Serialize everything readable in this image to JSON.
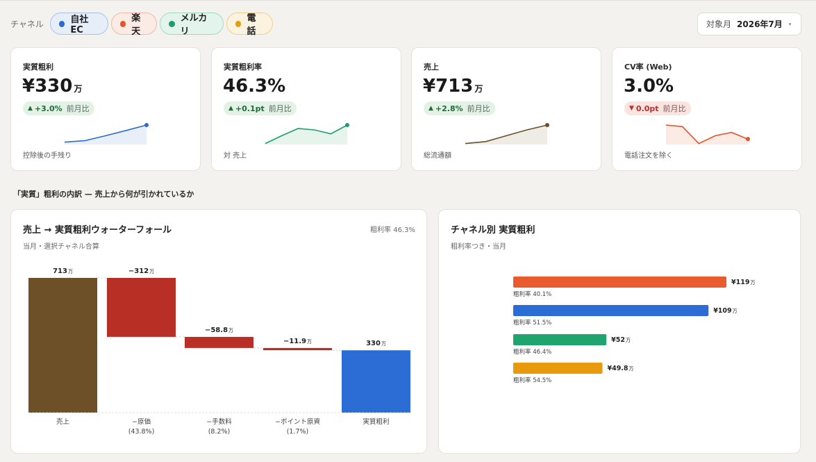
{
  "filters": {
    "channel_label": "チャネル",
    "channels": [
      {
        "name": "自社EC",
        "dot": "#2b6bd1",
        "bg": "#e6eef9",
        "border": "#a9c1ea"
      },
      {
        "name": "楽天",
        "dot": "#e0552b",
        "bg": "#fcebe4",
        "border": "#f0b9a5"
      },
      {
        "name": "メルカリ",
        "dot": "#1a9e6a",
        "bg": "#e3f4ec",
        "border": "#a3d8bf"
      },
      {
        "name": "電話",
        "dot": "#e79b0e",
        "bg": "#fcf2e0",
        "border": "#f0cf94"
      }
    ],
    "month_key": "対象月",
    "month_value": "2026年7月",
    "caret": "▾"
  },
  "kpis": [
    {
      "title": "実質粗利",
      "value": "¥330",
      "unit": "万",
      "delta": "+3.0%",
      "direction": "up",
      "arrow": "▲",
      "compare": "前月比",
      "note": "控除後の手残り",
      "color": "#2b6bd1",
      "fill": "#e9eff9",
      "spark": [
        0.12,
        0.2,
        0.45,
        0.72,
        1.0
      ]
    },
    {
      "title": "実質粗利率",
      "value": "46.3%",
      "unit": "",
      "delta": "+0.1pt",
      "direction": "up",
      "arrow": "▲",
      "compare": "前月比",
      "note": "対 売上",
      "color": "#1a9e6a",
      "fill": "#e6f4ec",
      "spark": [
        0.05,
        0.45,
        0.82,
        0.75,
        0.55,
        1.0
      ]
    },
    {
      "title": "売上",
      "value": "¥713",
      "unit": "万",
      "delta": "+2.8%",
      "direction": "up",
      "arrow": "▲",
      "compare": "前月比",
      "note": "総流通額",
      "color": "#6a4f2b",
      "fill": "#efebe5",
      "spark": [
        0.05,
        0.15,
        0.45,
        0.75,
        1.0
      ]
    },
    {
      "title": "CV率 (Web)",
      "value": "3.0%",
      "unit": "",
      "delta": "0.0pt",
      "direction": "down",
      "arrow": "▼",
      "compare": "前月比",
      "note": "電話注文を除く",
      "color": "#e0552b",
      "fill": "#fcebe4",
      "spark": [
        1.0,
        0.92,
        0.05,
        0.45,
        0.62,
        0.28
      ]
    }
  ],
  "section_title": "「実質」粗利の内訳 — 売上から何が引かれているか",
  "waterfall": {
    "title": "売上 → 実質粗利ウォーターフォール",
    "subtitle": "当月・選択チャネル合算",
    "rate_label": "粗利率 46.3%",
    "unit": "万"
  },
  "channel_panel": {
    "title": "チャネル別 実質粗利",
    "subtitle": "粗利率つき・当月",
    "unit": "万"
  },
  "chart_data": [
    {
      "type": "bar",
      "title": "売上 → 実質粗利ウォーターフォール",
      "categories": [
        [
          "売上"
        ],
        [
          "−原価",
          "(43.8%)"
        ],
        [
          "−手数料",
          "(8.2%)"
        ],
        [
          "−ポイント原資",
          "(1.7%)"
        ],
        [
          "実質粗利"
        ]
      ],
      "values": [
        713,
        -312,
        -58.8,
        -11.9,
        330
      ],
      "labels": [
        "713",
        "−312",
        "−58.8",
        "−11.9",
        "330"
      ],
      "kinds": [
        "total",
        "decrease",
        "decrease",
        "decrease",
        "total"
      ],
      "colors": [
        "#6e5028",
        "#b83025",
        "#b83025",
        "#b83025",
        "#2b6dd4"
      ],
      "unit": "万",
      "ylim": [
        0,
        713
      ]
    },
    {
      "type": "bar",
      "orientation": "horizontal",
      "title": "チャネル別 実質粗利",
      "values": [
        119,
        109,
        52,
        49.8
      ],
      "labels": [
        "¥119",
        "¥109",
        "¥52",
        "¥49.8"
      ],
      "rates": [
        "粗利率 40.1%",
        "粗利率 51.5%",
        "粗利率 46.4%",
        "粗利率 54.5%"
      ],
      "colors": [
        "#e95a2c",
        "#2b6dd4",
        "#1fa46e",
        "#e89a0c"
      ],
      "unit": "万"
    }
  ]
}
